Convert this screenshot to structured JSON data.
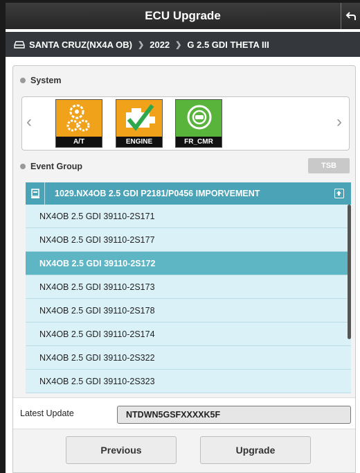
{
  "window": {
    "title": "ECU Upgrade"
  },
  "breadcrumb": {
    "items": [
      "SANTA CRUZ(NX4A OB)",
      "2022",
      "G 2.5 GDI THETA III"
    ]
  },
  "system": {
    "header": "System",
    "tiles": [
      {
        "label": "A/T",
        "icon": "gears-icon",
        "color": "#f0a21b"
      },
      {
        "label": "ENGINE",
        "icon": "engine-check-icon",
        "color": "#f0a21b"
      },
      {
        "label": "FR_CMR",
        "icon": "camera-icon",
        "color": "#59b43c"
      }
    ]
  },
  "event_group": {
    "header": "Event Group",
    "tsb_label": "TSB",
    "group_title": "1029.NX4OB 2.5 GDI P2181/P0456 IMPORVEMENT",
    "items": [
      "NX4OB 2.5 GDI 39110-2S171",
      "NX4OB 2.5 GDI 39110-2S177",
      "NX4OB 2.5 GDI 39110-2S172",
      "NX4OB 2.5 GDI 39110-2S173",
      "NX4OB 2.5 GDI 39110-2S178",
      "NX4OB 2.5 GDI 39110-2S174",
      "NX4OB 2.5 GDI 39110-2S322",
      "NX4OB 2.5 GDI 39110-2S323"
    ],
    "selected_index": 2
  },
  "latest_update": {
    "label": "Latest Update",
    "value": "NTDWN5GSFXXXXK5F"
  },
  "buttons": {
    "previous": "Previous",
    "upgrade": "Upgrade"
  }
}
